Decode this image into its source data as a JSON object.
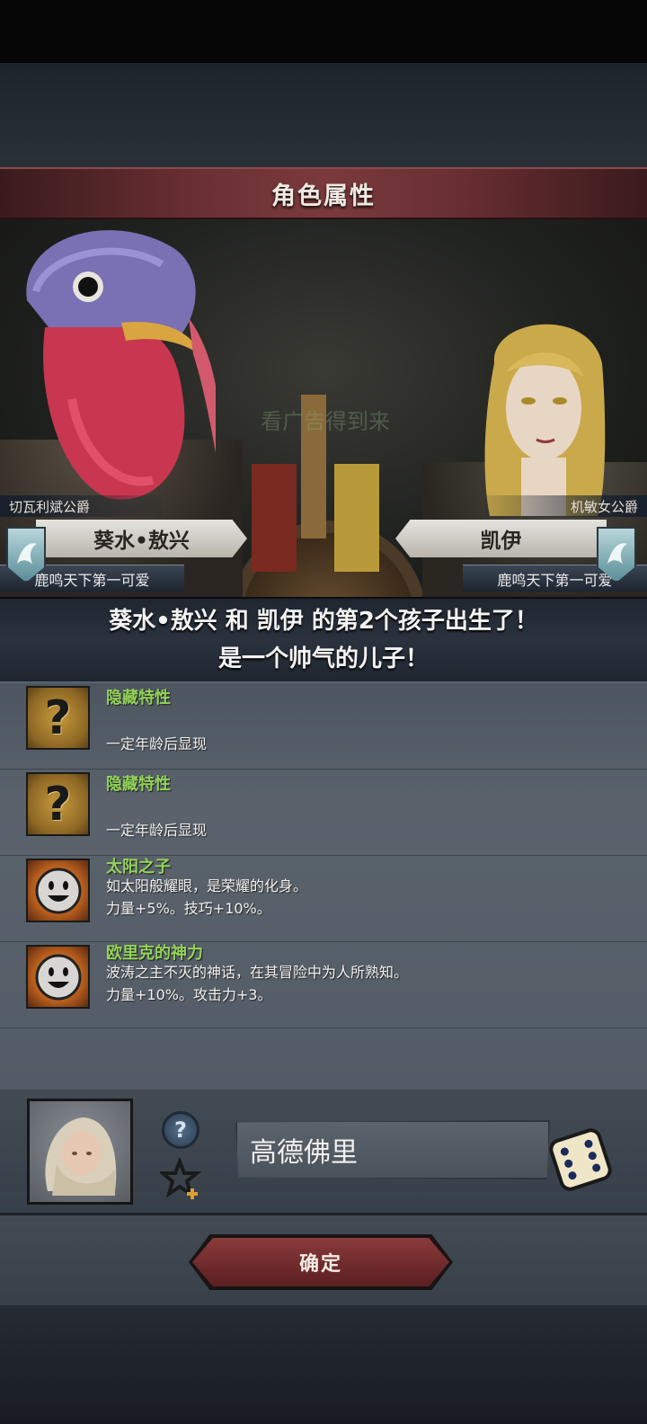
{
  "header": {
    "title": "角色属性"
  },
  "scene": {
    "watermark_text": "看广告得到来"
  },
  "parents": {
    "left": {
      "title": "切瓦利斌公爵",
      "name": "葵水•敖兴",
      "subtitle": "鹿鸣天下第一可爱"
    },
    "right": {
      "title": "机敏女公爵",
      "name": "凯伊",
      "subtitle": "鹿鸣天下第一可爱"
    }
  },
  "announcement": {
    "line1": "葵水•敖兴 和 凯伊 的第2个孩子出生了！",
    "line2": "是一个帅气的儿子！"
  },
  "traits": [
    {
      "name": "隐藏特性",
      "desc1": "",
      "desc2": "一定年龄后显现",
      "icon": "question-mark-icon"
    },
    {
      "name": "隐藏特性",
      "desc1": "",
      "desc2": "一定年龄后显现",
      "icon": "question-mark-icon"
    },
    {
      "name": "太阳之子",
      "desc1": "如太阳般耀眼，是荣耀的化身。",
      "desc2": "力量+5%。技巧+10%。",
      "icon": "sun-face-icon"
    },
    {
      "name": "欧里克的神力",
      "desc1": "波涛之主不灭的神话，在其冒险中为人所熟知。",
      "desc2": "力量+10%。攻击力+3。",
      "icon": "sun-face-icon"
    }
  ],
  "child": {
    "help_glyph": "?",
    "name_value": "高德佛里"
  },
  "footer": {
    "confirm_label": "确定"
  },
  "colors": {
    "trait_name": "#93d35a",
    "title_bar": "#6a2f33",
    "confirm": "#8a3a3a"
  }
}
